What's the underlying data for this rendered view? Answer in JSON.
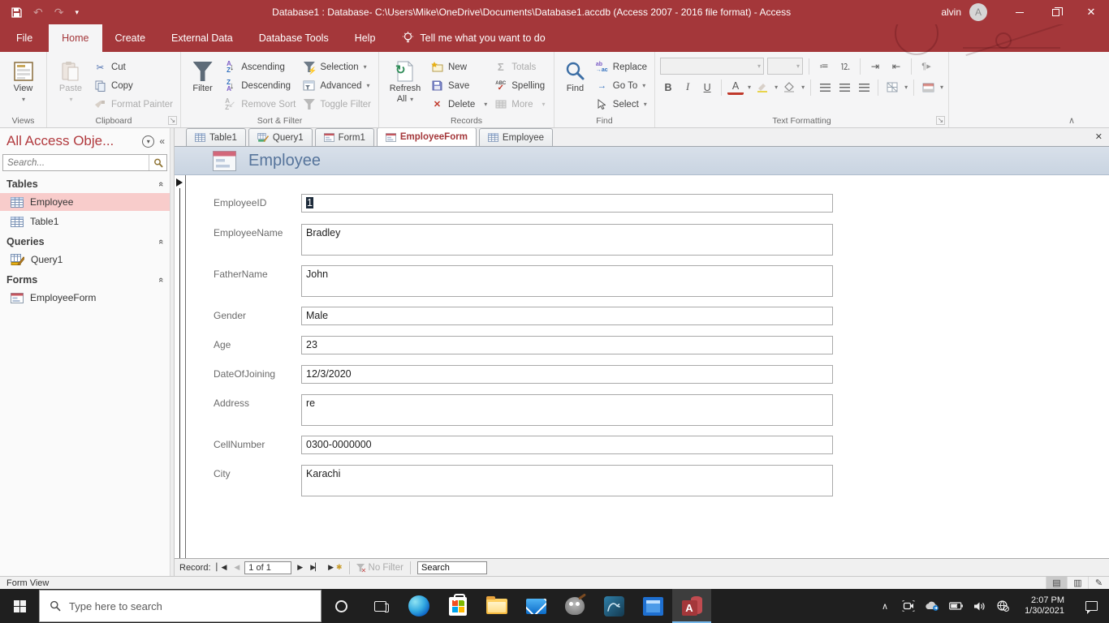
{
  "titlebar": {
    "title": "Database1 : Database- C:\\Users\\Mike\\OneDrive\\Documents\\Database1.accdb (Access 2007 - 2016 file format)  -  Access",
    "user": "alvin",
    "avatar": "A"
  },
  "menu": {
    "tabs": [
      "File",
      "Home",
      "Create",
      "External Data",
      "Database Tools",
      "Help"
    ],
    "tell_me": "Tell me what you want to do"
  },
  "ribbon": {
    "views": {
      "label": "Views",
      "view": "View"
    },
    "clipboard": {
      "label": "Clipboard",
      "paste": "Paste",
      "cut": "Cut",
      "copy": "Copy",
      "format_painter": "Format Painter"
    },
    "sort_filter": {
      "label": "Sort & Filter",
      "filter": "Filter",
      "ascending": "Ascending",
      "descending": "Descending",
      "remove_sort": "Remove Sort",
      "selection": "Selection",
      "advanced": "Advanced",
      "toggle_filter": "Toggle Filter"
    },
    "records": {
      "label": "Records",
      "refresh_line1": "Refresh",
      "refresh_line2": "All",
      "new": "New",
      "save": "Save",
      "delete": "Delete",
      "totals": "Totals",
      "spelling": "Spelling",
      "more": "More"
    },
    "find": {
      "label": "Find",
      "find": "Find",
      "replace": "Replace",
      "goto": "Go To",
      "select": "Select"
    },
    "text_formatting": {
      "label": "Text Formatting",
      "bold": "B",
      "italic": "I",
      "underline": "U",
      "font_color": "A"
    }
  },
  "nav": {
    "title": "All Access Obje...",
    "search_placeholder": "Search...",
    "tables_header": "Tables",
    "queries_header": "Queries",
    "forms_header": "Forms",
    "items": {
      "employee": "Employee",
      "table1": "Table1",
      "query1": "Query1",
      "employeeform": "EmployeeForm"
    }
  },
  "doc_tabs": {
    "table1": "Table1",
    "query1": "Query1",
    "form1": "Form1",
    "employeeform": "EmployeeForm",
    "employee": "Employee"
  },
  "form": {
    "title": "Employee",
    "fields": [
      {
        "label": "EmployeeID",
        "value": "1"
      },
      {
        "label": "EmployeeName",
        "value": "Bradley"
      },
      {
        "label": "FatherName",
        "value": "John"
      },
      {
        "label": "Gender",
        "value": "Male"
      },
      {
        "label": "Age",
        "value": "23"
      },
      {
        "label": "DateOfJoining",
        "value": "12/3/2020"
      },
      {
        "label": "Address",
        "value": "re"
      },
      {
        "label": "CellNumber",
        "value": "0300-0000000"
      },
      {
        "label": "City",
        "value": "Karachi"
      }
    ]
  },
  "recordnav": {
    "label": "Record:",
    "position": "1 of 1",
    "no_filter": "No Filter",
    "search_placeholder": "Search"
  },
  "statusbar": {
    "text": "Form View"
  },
  "taskbar": {
    "search_placeholder": "Type here to search",
    "time": "2:07 PM",
    "date": "1/30/2021"
  },
  "icons": {
    "undo": "↶",
    "redo": "↷",
    "qat_more": "▾",
    "cut": "✂",
    "sigma": "Σ",
    "delete_x": "✕",
    "check": "✓",
    "goto_arrow": "→",
    "chevron_up_double": "«",
    "shutter": "«",
    "circle_chevron": "▾",
    "paragraph_dir": "¶▸",
    "record_first": "▏◀",
    "record_prev": "◀",
    "record_next": "▶",
    "record_last": "▶▏",
    "record_new": "▶",
    "new_star": "✱",
    "collapse_ribbon": "∧",
    "close": "✕",
    "tray_chevron": "∧",
    "status_form_view": "▤",
    "status_datasheet": "▥",
    "status_design": "✎",
    "list_bullets": "≔",
    "list_numbers": "⒓",
    "indent_more": "⇥",
    "indent_less": "⇤"
  },
  "colors": {
    "accent": "#A4373A",
    "active_tab_text": "#A4373A",
    "nav_selection": "#F8CCCB",
    "form_header_text": "#56749B",
    "form_header_bg": "#CFDAE6",
    "taskbar_bg": "#1F1F1F",
    "active_app_underline": "#76B9ED",
    "disabled_text": "#ACACAC"
  }
}
